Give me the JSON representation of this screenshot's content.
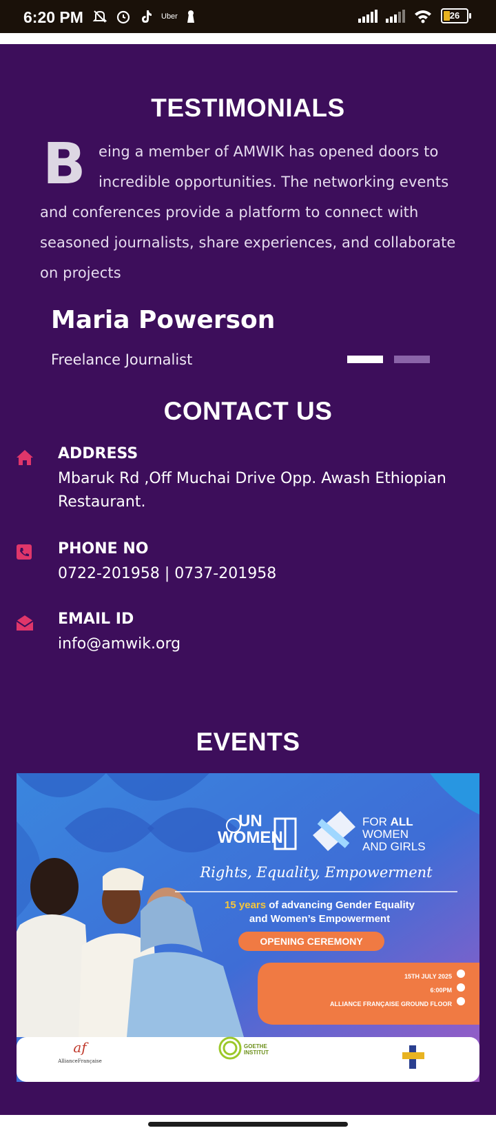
{
  "status_bar": {
    "time": "6:20 PM",
    "uber": "Uber",
    "battery": "26"
  },
  "testimonials": {
    "heading": "TESTIMONIALS",
    "dropcap": "B",
    "lines": [
      "eing a member of AMWIK has opened doors to",
      "incredible opportunities. The networking events",
      "and conferences provide a platform to connect with",
      "seasoned journalists, share experiences, and collaborate",
      "on projects"
    ],
    "name": "Maria Powerson",
    "role": "Freelance Journalist"
  },
  "contact": {
    "heading": "CONTACT US",
    "address_label": "ADDRESS",
    "address_line1": "Mbaruk Rd ,Off Muchai Drive Opp. Awash Ethiopian",
    "address_line2": "Restaurant.",
    "phone_label": "PHONE NO",
    "phone_value": "0722-201958 | 0737-201958",
    "email_label": "EMAIL ID",
    "email_value": "info@amwik.org"
  },
  "events": {
    "heading": "EVENTS",
    "poster": {
      "un": "UN",
      "women": "WOMEN",
      "for": "FOR",
      "all": "ALL",
      "women2": "WOMEN",
      "and_girls": "AND GIRLS",
      "tagline": "Rights, Equality, Empowerment",
      "years_highlight": "15 years",
      "years_rest": " of advancing Gender Equality",
      "line2": "and Women’s Empowerment",
      "ceremony": "OPENING CEREMONY",
      "date": "15TH JULY 2025",
      "time": "6:00PM",
      "venue": "ALLIANCE FRANÇAISE GROUND FLOOR",
      "goethe1": "GOETHE",
      "goethe2": "INSTITUT",
      "af_logo": "af",
      "af_text": "AllianceFrançaise"
    }
  },
  "colors": {
    "background": "#3d0e5b",
    "accent": "#e0366a",
    "white": "#ffffff",
    "orange": "#f07a43"
  }
}
